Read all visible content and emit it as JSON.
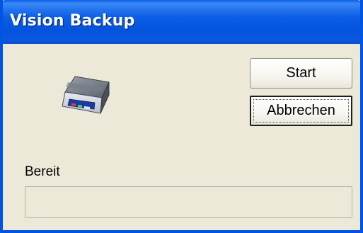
{
  "window": {
    "title": "Vision Backup"
  },
  "buttons": {
    "start_label": "Start",
    "cancel_label": "Abbrechen"
  },
  "status": {
    "text": "Bereit"
  },
  "progress": {
    "value": 0
  },
  "icons": {
    "device": "backup-device-icon"
  },
  "colors": {
    "titlebar": "#0054e3",
    "window_bg": "#ece9d8"
  }
}
